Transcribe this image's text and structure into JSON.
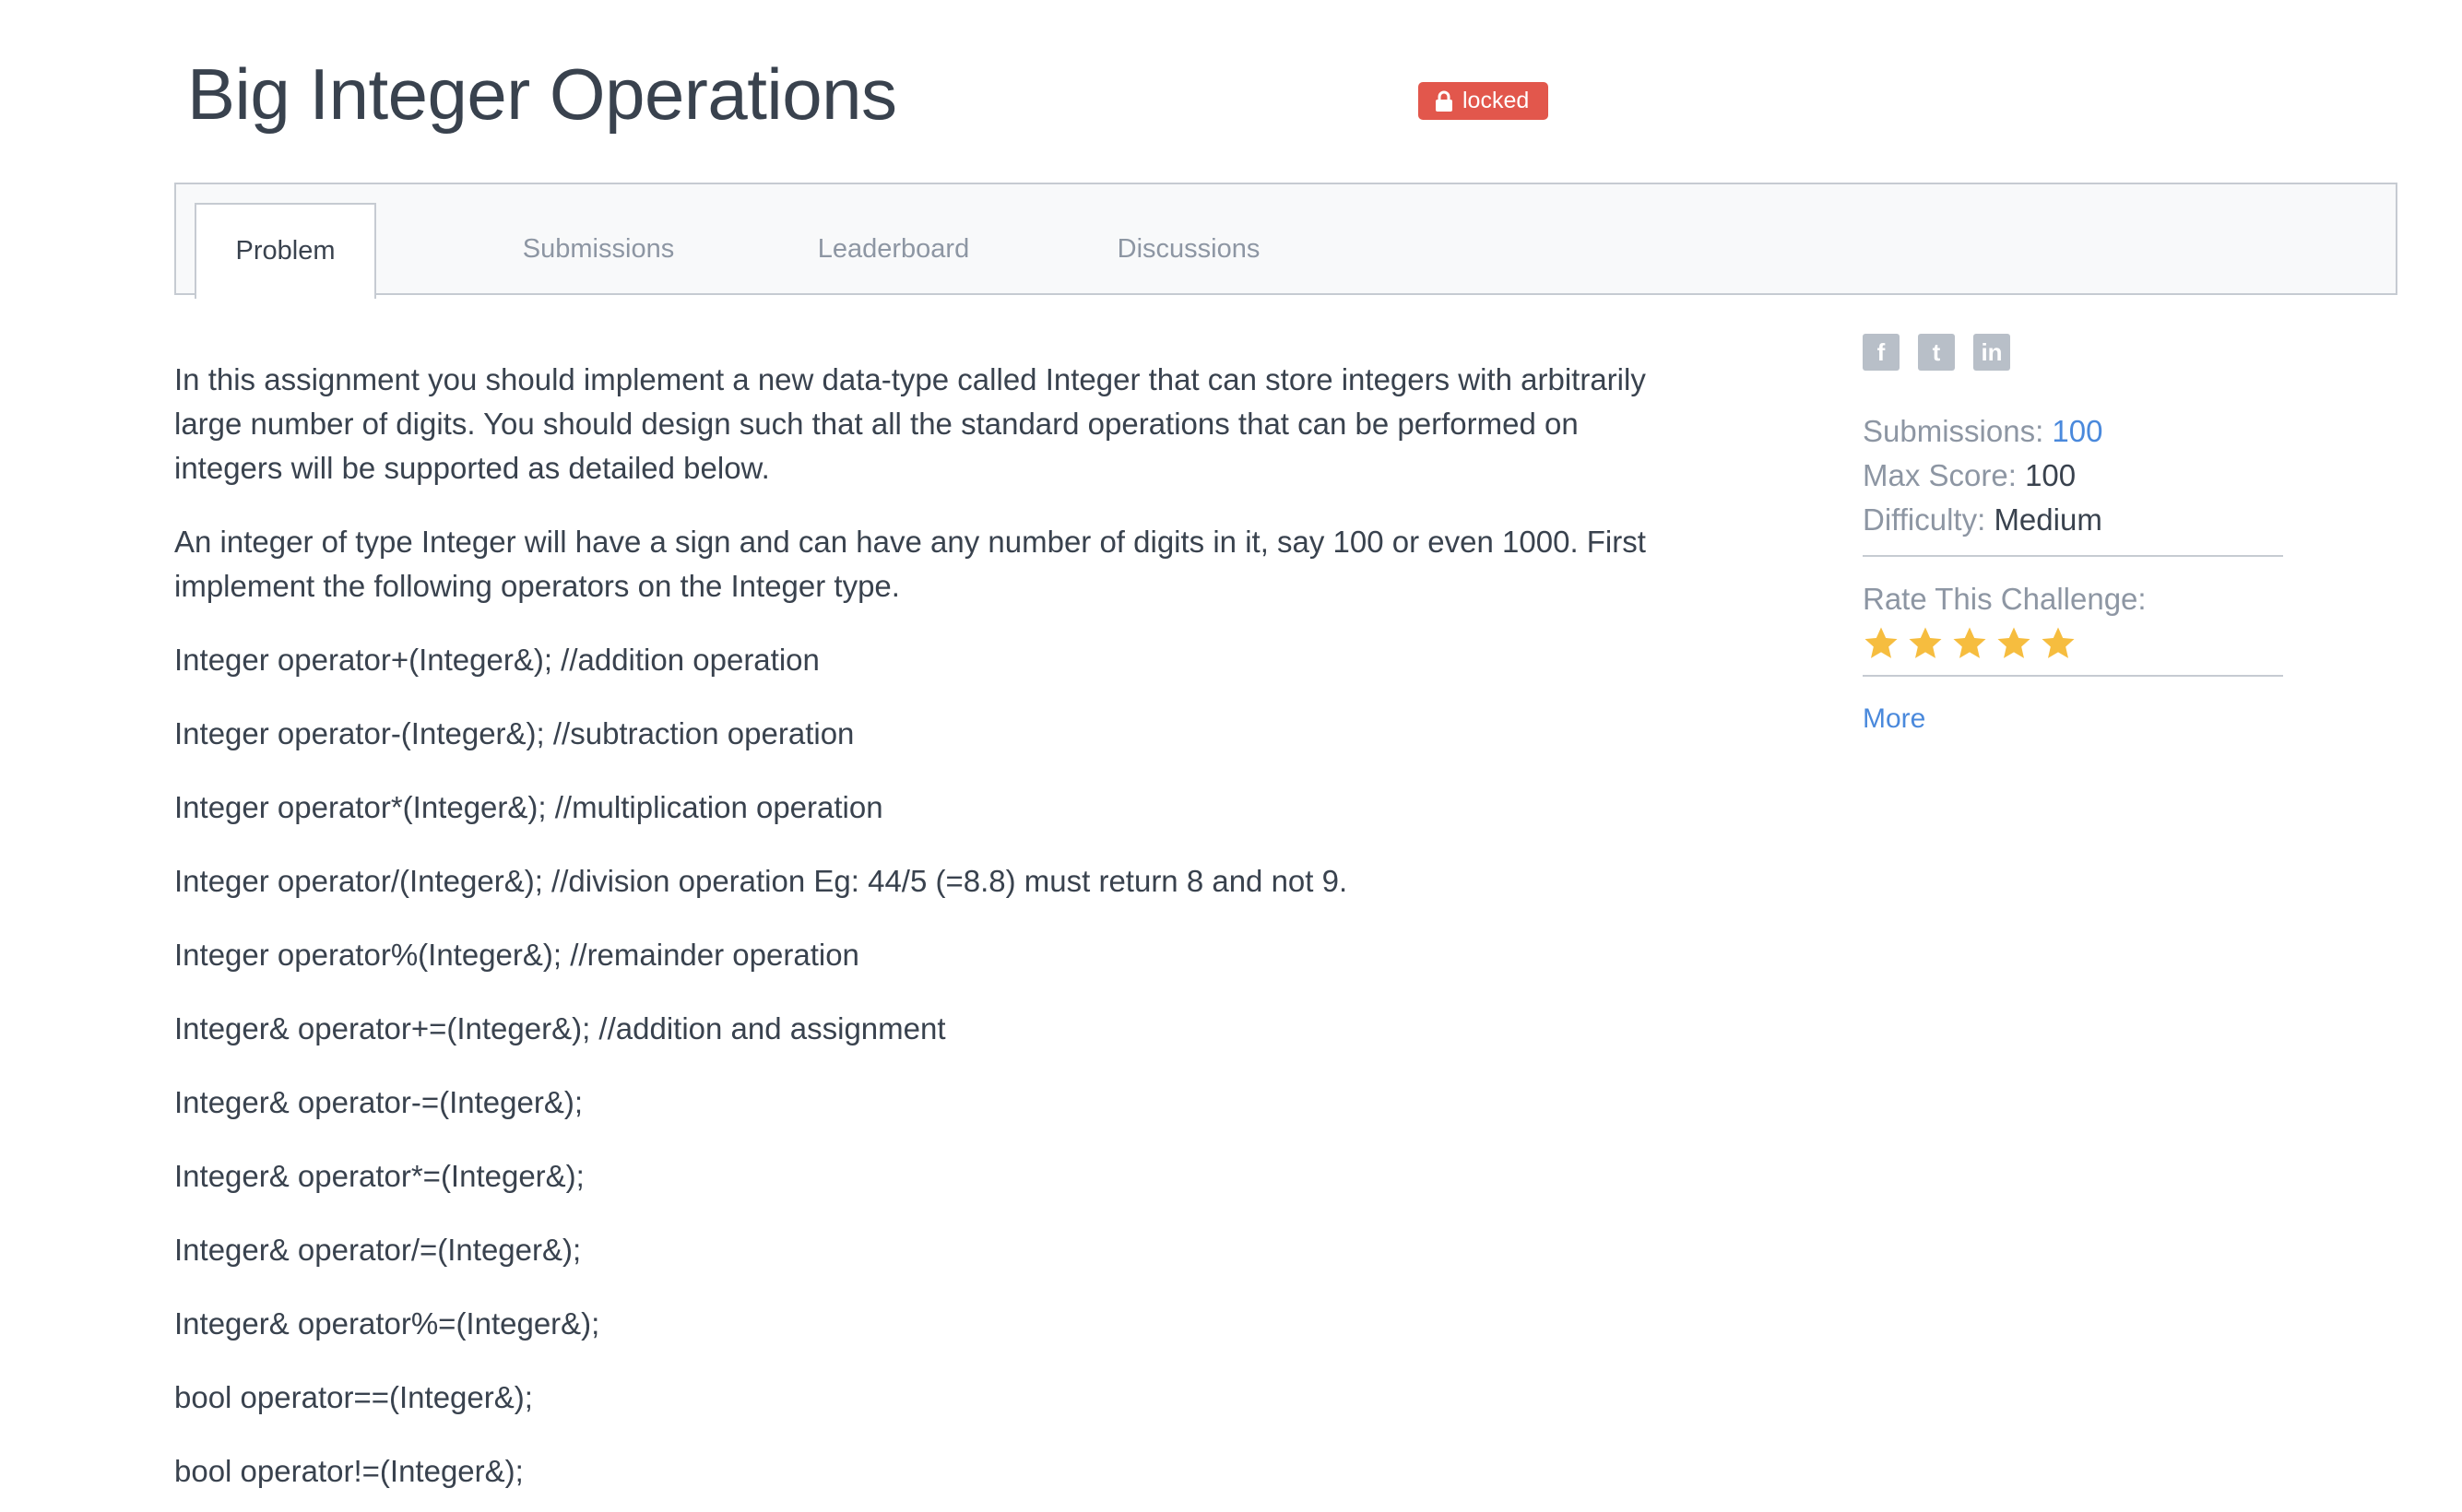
{
  "header": {
    "title": "Big Integer Operations",
    "badge": "locked",
    "badge_color": "#e2574c"
  },
  "tabs": [
    {
      "label": "Problem",
      "active": true
    },
    {
      "label": "Submissions",
      "active": false
    },
    {
      "label": "Leaderboard",
      "active": false
    },
    {
      "label": "Discussions",
      "active": false
    }
  ],
  "problem": {
    "paragraphs": [
      "In this assignment you should implement a new data-type called Integer that can store integers with arbitrarily large number of digits. You should design such that all the standard operations that can be performed on integers will be supported as detailed below.",
      "An integer of type Integer will have a sign and can have any number of digits in it, say 100 or even 1000. First implement the following operators on the Integer type.",
      "Integer operator+(Integer&); //addition operation",
      "Integer operator-(Integer&); //subtraction operation",
      "Integer operator*(Integer&); //multiplication operation",
      "Integer operator/(Integer&); //division operation Eg: 44/5 (=8.8) must return 8 and not 9.",
      "Integer operator%(Integer&); //remainder operation",
      "Integer& operator+=(Integer&); //addition and assignment",
      "Integer& operator-=(Integer&);",
      "Integer& operator*=(Integer&);",
      "Integer& operator/=(Integer&);",
      "Integer& operator%=(Integer&);",
      "bool operator==(Integer&);",
      "bool operator!=(Integer&);"
    ]
  },
  "sidebar": {
    "share_icons": [
      "facebook-icon",
      "twitter-icon",
      "linkedin-icon"
    ],
    "share_glyphs": [
      "f",
      "t",
      "in"
    ],
    "submissions_label": "Submissions:",
    "submissions_value": "100",
    "max_score_label": "Max Score:",
    "max_score_value": "100",
    "difficulty_label": "Difficulty:",
    "difficulty_value": "Medium",
    "rate_label": "Rate This Challenge:",
    "rating_stars": 5,
    "star_color": "#f6bd3f",
    "more_label": "More"
  }
}
